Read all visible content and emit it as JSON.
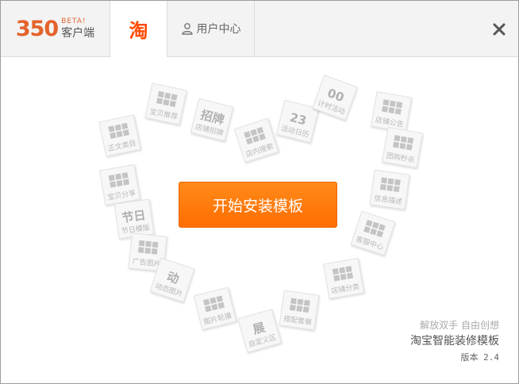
{
  "header": {
    "logo_number": "350",
    "logo_beta": "BETA!",
    "logo_client": "客户端",
    "taobao_tab_glyph": "淘",
    "user_tab_label": "用户中心"
  },
  "main": {
    "install_button_label": "开始安装模板",
    "slogan": "解放双手 自由创想",
    "product_name": "淘宝智能装修模板",
    "version": "版本 2.4"
  },
  "tiles": [
    {
      "label": "宝贝推荐",
      "big": ""
    },
    {
      "label": "店铺招牌",
      "big": "招牌"
    },
    {
      "label": "店内搜索",
      "big": ""
    },
    {
      "label": "活动日历",
      "big": "23"
    },
    {
      "label": "计时活动",
      "big": "00"
    },
    {
      "label": "店铺公告",
      "big": ""
    },
    {
      "label": "正文类目",
      "big": ""
    },
    {
      "label": "团购秒杀",
      "big": ""
    },
    {
      "label": "宝贝分享",
      "big": ""
    },
    {
      "label": "信息描述",
      "big": ""
    },
    {
      "label": "节日模版",
      "big": "节日"
    },
    {
      "label": "客服中心",
      "big": ""
    },
    {
      "label": "广告图片",
      "big": ""
    },
    {
      "label": "店铺分类",
      "big": ""
    },
    {
      "label": "动态图片",
      "big": "动"
    },
    {
      "label": "搭配套餐",
      "big": ""
    },
    {
      "label": "图片轮播",
      "big": ""
    },
    {
      "label": "自定义区",
      "big": "展"
    }
  ],
  "colors": {
    "accent": "#ff7300",
    "logo_orange": "#e4632c",
    "logo_blue": "#22a0d2",
    "taobao_red": "#ff4a00"
  }
}
